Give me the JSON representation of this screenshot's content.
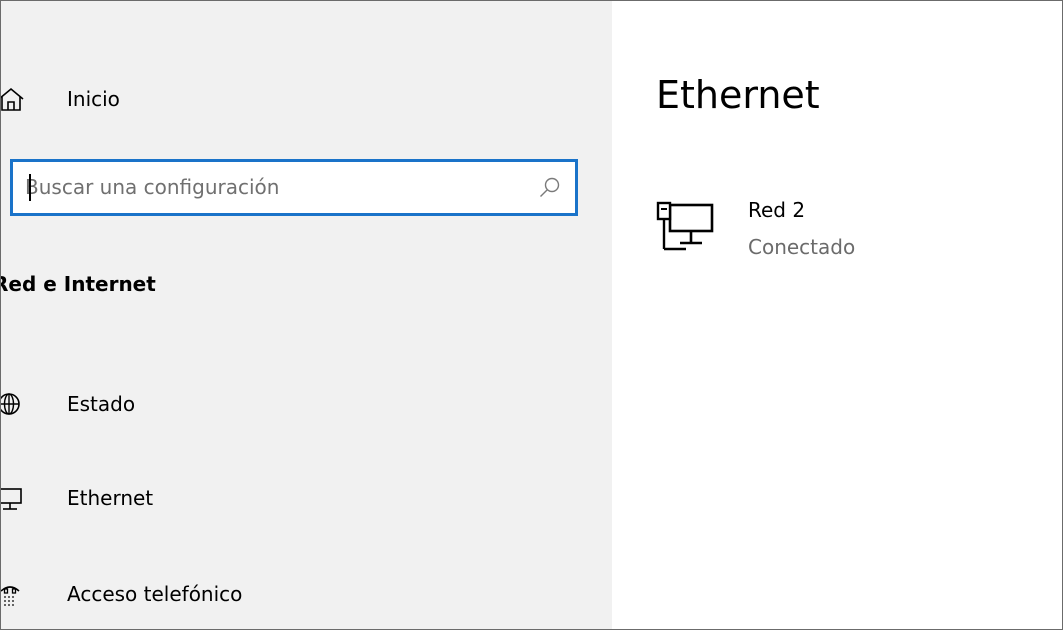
{
  "sidebar": {
    "home_label": "Inicio",
    "search": {
      "value": "",
      "placeholder": "Buscar una configuración"
    },
    "section_title": "Red e Internet",
    "items": [
      {
        "label": "Estado",
        "icon": "globe-icon"
      },
      {
        "label": "Ethernet",
        "icon": "monitor-icon"
      },
      {
        "label": "Acceso telefónico",
        "icon": "dial-up-icon"
      }
    ]
  },
  "main": {
    "title": "Ethernet",
    "network": {
      "name": "Red 2",
      "status": "Conectado",
      "icon": "wired-network-icon"
    }
  },
  "colors": {
    "sidebar_background": "#f1f1f1",
    "content_background": "#ffffff",
    "focus_accent": "#1a73c9",
    "secondary_text": "#6b6b6b"
  }
}
